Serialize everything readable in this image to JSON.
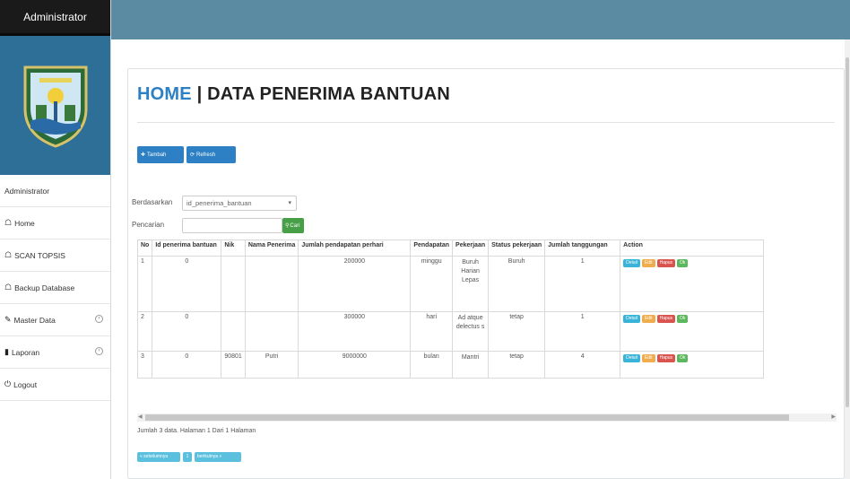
{
  "sidebar": {
    "brand": "Administrator",
    "user_label": "Administrator",
    "items": [
      {
        "label": "Home",
        "icon": "home-icon"
      },
      {
        "label": "SCAN TOPSIS",
        "icon": "home-icon"
      },
      {
        "label": "Backup Database",
        "icon": "home-icon"
      },
      {
        "label": "Master Data",
        "icon": "edit-icon",
        "expandable": true
      },
      {
        "label": "Laporan",
        "icon": "file-icon",
        "expandable": true
      },
      {
        "label": "Logout",
        "icon": "power-icon"
      }
    ]
  },
  "page": {
    "title_home": "HOME",
    "title_sep": "|",
    "title_rest": "DATA PENERIMA BANTUAN"
  },
  "toolbar": {
    "tambah": "Tambah",
    "refresh": "Refresh"
  },
  "filter": {
    "by_label": "Berdasarkan",
    "by_value": "id_penerima_bantuan",
    "search_label": "Pencarian",
    "search_value": "",
    "search_button": "Cari"
  },
  "table": {
    "headers": [
      "No",
      "Id penerima bantuan",
      "Nik",
      "Nama Penerima",
      "Jumlah pendapatan perhari",
      "Pendapatan",
      "Pekerjaan",
      "Status pekerjaan",
      "Jumlah tanggungan",
      "Action"
    ],
    "rows": [
      {
        "no": "1",
        "id": "0",
        "nik": "",
        "nama": "",
        "jumlah": "200000",
        "pendapatan": "minggu",
        "pekerjaan": "Buruh Harian Lepas",
        "status": "Buruh",
        "tanggungan": "1"
      },
      {
        "no": "2",
        "id": "0",
        "nik": "",
        "nama": "",
        "jumlah": "300000",
        "pendapatan": "hari",
        "pekerjaan": "Ad atque delectus s",
        "status": "tetap",
        "tanggungan": "1"
      },
      {
        "no": "3",
        "id": "0",
        "nik": "90801",
        "nama": "Putri",
        "jumlah": "9000000",
        "pendapatan": "bulan",
        "pekerjaan": "Mantri",
        "status": "tetap",
        "tanggungan": "4"
      }
    ],
    "actions": {
      "detail": "Detail",
      "edit": "Edit",
      "hapus": "Hapus",
      "ok": "Ok"
    }
  },
  "summary": "Jumlah 3 data. Halaman 1 Dari 1 Halaman",
  "pagination": {
    "prev": "« sebelumnya",
    "page": "1",
    "next": "berikutnya »"
  },
  "colors": {
    "topbar": "#5b8aa3",
    "brand_bg": "#1a1a1a",
    "primary": "#2d80c3",
    "success": "#47a047"
  }
}
